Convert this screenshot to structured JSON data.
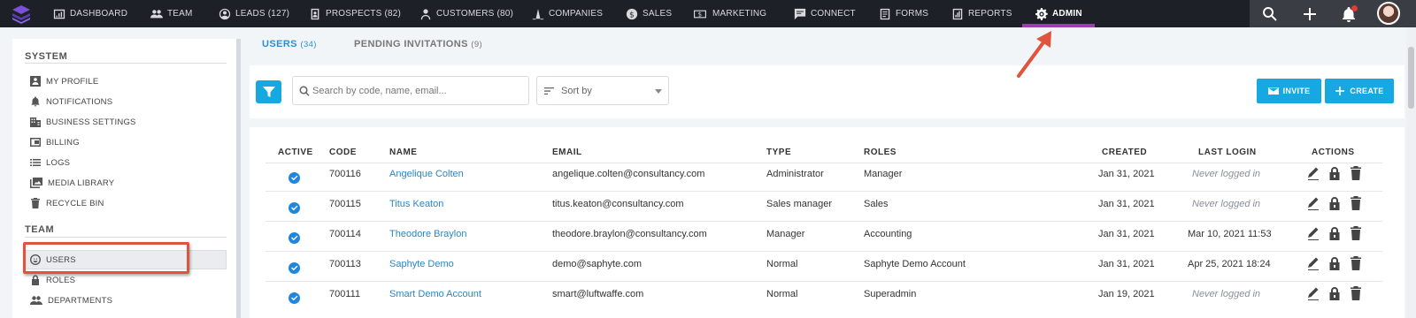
{
  "nav": {
    "items": [
      {
        "label": "DASHBOARD",
        "icon": "dashboard-icon"
      },
      {
        "label": "TEAM",
        "icon": "team-icon"
      },
      {
        "label": "LEADS (127)",
        "icon": "leads-icon"
      },
      {
        "label": "PROSPECTS (82)",
        "icon": "prospects-icon"
      },
      {
        "label": "CUSTOMERS (80)",
        "icon": "customers-icon"
      },
      {
        "label": "COMPANIES",
        "icon": "companies-icon"
      },
      {
        "label": "SALES",
        "icon": "sales-icon"
      },
      {
        "label": "MARKETING",
        "icon": "marketing-icon"
      },
      {
        "label": "CONNECT",
        "icon": "connect-icon"
      },
      {
        "label": "FORMS",
        "icon": "forms-icon"
      },
      {
        "label": "REPORTS",
        "icon": "reports-icon"
      },
      {
        "label": "ADMIN",
        "icon": "admin-gear-icon",
        "active": true
      }
    ],
    "accent_underline": "#9b3fae",
    "right_buttons": [
      "search-icon",
      "plus-icon",
      "bell-icon",
      "avatar"
    ]
  },
  "sidebar": {
    "system_heading": "SYSTEM",
    "system_items": [
      {
        "label": "MY PROFILE",
        "icon": "profile-icon"
      },
      {
        "label": "NOTIFICATIONS",
        "icon": "bell-icon"
      },
      {
        "label": "BUSINESS SETTINGS",
        "icon": "building-icon"
      },
      {
        "label": "BILLING",
        "icon": "billing-icon"
      },
      {
        "label": "LOGS",
        "icon": "list-icon"
      },
      {
        "label": "MEDIA LIBRARY",
        "icon": "media-icon"
      },
      {
        "label": "RECYCLE BIN",
        "icon": "trash-icon"
      }
    ],
    "team_heading": "TEAM",
    "team_items": [
      {
        "label": "USERS",
        "icon": "user-face-icon",
        "selected": true
      },
      {
        "label": "ROLES",
        "icon": "lock-icon"
      },
      {
        "label": "DEPARTMENTS",
        "icon": "group-icon"
      }
    ]
  },
  "tabs": [
    {
      "label": "USERS",
      "count": "(34)",
      "active": true
    },
    {
      "label": "PENDING INVITATIONS",
      "count": "(9)",
      "active": false
    }
  ],
  "toolbar": {
    "search_placeholder": "Search by code, name, email...",
    "sort_label": "Sort by",
    "invite_label": "INVITE",
    "create_label": "CREATE",
    "accent": "#16a9e1"
  },
  "table": {
    "columns": [
      "ACTIVE",
      "CODE",
      "NAME",
      "EMAIL",
      "TYPE",
      "ROLES",
      "CREATED",
      "LAST LOGIN",
      "ACTIONS"
    ],
    "rows": [
      {
        "active": true,
        "code": "700116",
        "name": "Angelique Colten",
        "email": "angelique.colten@consultancy.com",
        "type": "Administrator",
        "roles": "Manager",
        "created": "Jan 31, 2021",
        "last_login": "Never logged in"
      },
      {
        "active": true,
        "code": "700115",
        "name": "Titus Keaton",
        "email": "titus.keaton@consultancy.com",
        "type": "Sales manager",
        "roles": "Sales",
        "created": "Jan 31, 2021",
        "last_login": "Never logged in"
      },
      {
        "active": true,
        "code": "700114",
        "name": "Theodore Braylon",
        "email": "theodore.braylon@consultancy.com",
        "type": "Manager",
        "roles": "Accounting",
        "created": "Jan 31, 2021",
        "last_login": "Mar 10, 2021 11:53"
      },
      {
        "active": true,
        "code": "700113",
        "name": "Saphyte Demo",
        "email": "demo@saphyte.com",
        "type": "Normal",
        "roles": "Saphyte Demo Account",
        "created": "Jan 31, 2021",
        "last_login": "Apr 25, 2021 18:24"
      },
      {
        "active": true,
        "code": "700111",
        "name": "Smart Demo Account",
        "email": "smart@luftwaffe.com",
        "type": "Normal",
        "roles": "Superadmin",
        "created": "Jan 19, 2021",
        "last_login": "Never logged in"
      }
    ],
    "row_actions": [
      "edit-icon",
      "lock-icon",
      "delete-icon"
    ]
  },
  "annotations": {
    "highlight_color": "#e0533d"
  }
}
